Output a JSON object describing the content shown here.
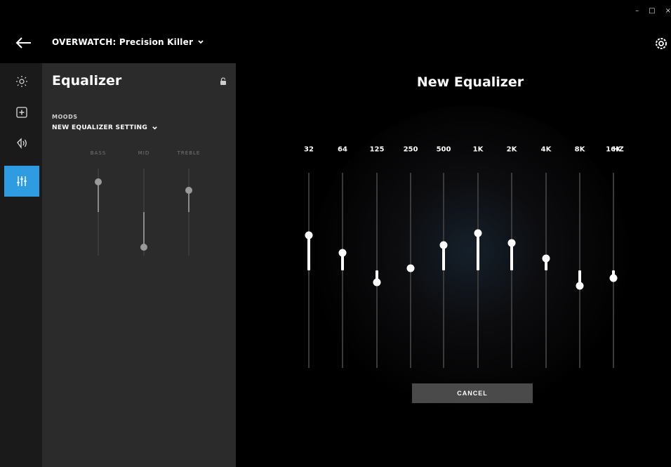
{
  "header": {
    "profile_name": "OVERWATCH: Precision Killer",
    "window_controls": [
      "–",
      "□",
      "×"
    ]
  },
  "rail": {
    "items": [
      {
        "icon": "lighting-icon",
        "active": false
      },
      {
        "icon": "assignments-icon",
        "active": false
      },
      {
        "icon": "sound-icon",
        "active": false
      },
      {
        "icon": "equalizer-icon",
        "active": true
      }
    ],
    "active_color": "#2f9be0"
  },
  "panel": {
    "title": "Equalizer",
    "moods_label": "MOODS",
    "mood_value": "NEW EQUALIZER SETTING",
    "mini_eq": [
      {
        "label": "BASS",
        "level": 0.85
      },
      {
        "label": "MID",
        "level": 0.1
      },
      {
        "label": "TREBLE",
        "level": 0.75
      }
    ]
  },
  "main": {
    "title": "New Equalizer",
    "unit_label": "HZ",
    "bands": [
      {
        "label": "32",
        "level": 0.68
      },
      {
        "label": "64",
        "level": 0.59
      },
      {
        "label": "125",
        "level": 0.44
      },
      {
        "label": "250",
        "level": 0.51
      },
      {
        "label": "500",
        "level": 0.63
      },
      {
        "label": "1K",
        "level": 0.69
      },
      {
        "label": "2K",
        "level": 0.64
      },
      {
        "label": "4K",
        "level": 0.56
      },
      {
        "label": "8K",
        "level": 0.42
      },
      {
        "label": "16K",
        "level": 0.46
      }
    ],
    "cancel_label": "CANCEL"
  }
}
